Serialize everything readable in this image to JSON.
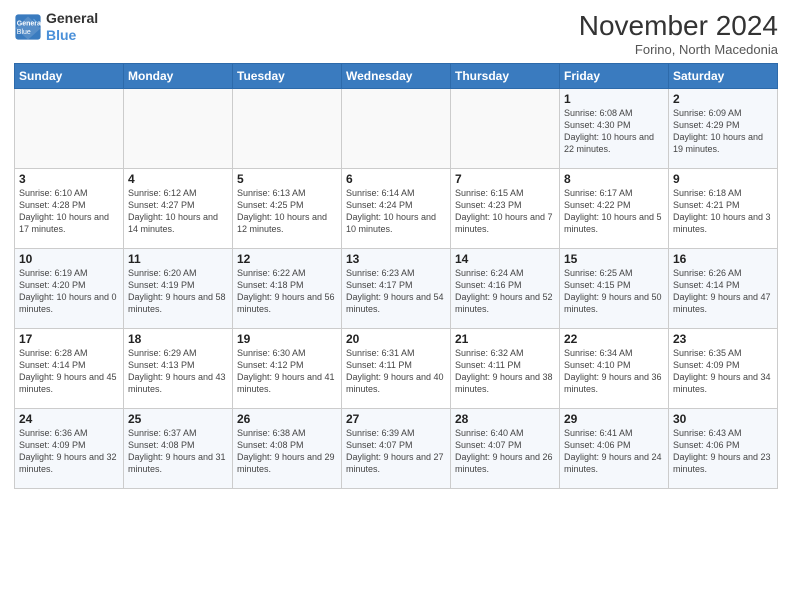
{
  "header": {
    "logo_line1": "General",
    "logo_line2": "Blue",
    "month_title": "November 2024",
    "subtitle": "Forino, North Macedonia"
  },
  "weekdays": [
    "Sunday",
    "Monday",
    "Tuesday",
    "Wednesday",
    "Thursday",
    "Friday",
    "Saturday"
  ],
  "weeks": [
    [
      {
        "day": "",
        "info": ""
      },
      {
        "day": "",
        "info": ""
      },
      {
        "day": "",
        "info": ""
      },
      {
        "day": "",
        "info": ""
      },
      {
        "day": "",
        "info": ""
      },
      {
        "day": "1",
        "info": "Sunrise: 6:08 AM\nSunset: 4:30 PM\nDaylight: 10 hours and 22 minutes."
      },
      {
        "day": "2",
        "info": "Sunrise: 6:09 AM\nSunset: 4:29 PM\nDaylight: 10 hours and 19 minutes."
      }
    ],
    [
      {
        "day": "3",
        "info": "Sunrise: 6:10 AM\nSunset: 4:28 PM\nDaylight: 10 hours and 17 minutes."
      },
      {
        "day": "4",
        "info": "Sunrise: 6:12 AM\nSunset: 4:27 PM\nDaylight: 10 hours and 14 minutes."
      },
      {
        "day": "5",
        "info": "Sunrise: 6:13 AM\nSunset: 4:25 PM\nDaylight: 10 hours and 12 minutes."
      },
      {
        "day": "6",
        "info": "Sunrise: 6:14 AM\nSunset: 4:24 PM\nDaylight: 10 hours and 10 minutes."
      },
      {
        "day": "7",
        "info": "Sunrise: 6:15 AM\nSunset: 4:23 PM\nDaylight: 10 hours and 7 minutes."
      },
      {
        "day": "8",
        "info": "Sunrise: 6:17 AM\nSunset: 4:22 PM\nDaylight: 10 hours and 5 minutes."
      },
      {
        "day": "9",
        "info": "Sunrise: 6:18 AM\nSunset: 4:21 PM\nDaylight: 10 hours and 3 minutes."
      }
    ],
    [
      {
        "day": "10",
        "info": "Sunrise: 6:19 AM\nSunset: 4:20 PM\nDaylight: 10 hours and 0 minutes."
      },
      {
        "day": "11",
        "info": "Sunrise: 6:20 AM\nSunset: 4:19 PM\nDaylight: 9 hours and 58 minutes."
      },
      {
        "day": "12",
        "info": "Sunrise: 6:22 AM\nSunset: 4:18 PM\nDaylight: 9 hours and 56 minutes."
      },
      {
        "day": "13",
        "info": "Sunrise: 6:23 AM\nSunset: 4:17 PM\nDaylight: 9 hours and 54 minutes."
      },
      {
        "day": "14",
        "info": "Sunrise: 6:24 AM\nSunset: 4:16 PM\nDaylight: 9 hours and 52 minutes."
      },
      {
        "day": "15",
        "info": "Sunrise: 6:25 AM\nSunset: 4:15 PM\nDaylight: 9 hours and 50 minutes."
      },
      {
        "day": "16",
        "info": "Sunrise: 6:26 AM\nSunset: 4:14 PM\nDaylight: 9 hours and 47 minutes."
      }
    ],
    [
      {
        "day": "17",
        "info": "Sunrise: 6:28 AM\nSunset: 4:14 PM\nDaylight: 9 hours and 45 minutes."
      },
      {
        "day": "18",
        "info": "Sunrise: 6:29 AM\nSunset: 4:13 PM\nDaylight: 9 hours and 43 minutes."
      },
      {
        "day": "19",
        "info": "Sunrise: 6:30 AM\nSunset: 4:12 PM\nDaylight: 9 hours and 41 minutes."
      },
      {
        "day": "20",
        "info": "Sunrise: 6:31 AM\nSunset: 4:11 PM\nDaylight: 9 hours and 40 minutes."
      },
      {
        "day": "21",
        "info": "Sunrise: 6:32 AM\nSunset: 4:11 PM\nDaylight: 9 hours and 38 minutes."
      },
      {
        "day": "22",
        "info": "Sunrise: 6:34 AM\nSunset: 4:10 PM\nDaylight: 9 hours and 36 minutes."
      },
      {
        "day": "23",
        "info": "Sunrise: 6:35 AM\nSunset: 4:09 PM\nDaylight: 9 hours and 34 minutes."
      }
    ],
    [
      {
        "day": "24",
        "info": "Sunrise: 6:36 AM\nSunset: 4:09 PM\nDaylight: 9 hours and 32 minutes."
      },
      {
        "day": "25",
        "info": "Sunrise: 6:37 AM\nSunset: 4:08 PM\nDaylight: 9 hours and 31 minutes."
      },
      {
        "day": "26",
        "info": "Sunrise: 6:38 AM\nSunset: 4:08 PM\nDaylight: 9 hours and 29 minutes."
      },
      {
        "day": "27",
        "info": "Sunrise: 6:39 AM\nSunset: 4:07 PM\nDaylight: 9 hours and 27 minutes."
      },
      {
        "day": "28",
        "info": "Sunrise: 6:40 AM\nSunset: 4:07 PM\nDaylight: 9 hours and 26 minutes."
      },
      {
        "day": "29",
        "info": "Sunrise: 6:41 AM\nSunset: 4:06 PM\nDaylight: 9 hours and 24 minutes."
      },
      {
        "day": "30",
        "info": "Sunrise: 6:43 AM\nSunset: 4:06 PM\nDaylight: 9 hours and 23 minutes."
      }
    ]
  ]
}
